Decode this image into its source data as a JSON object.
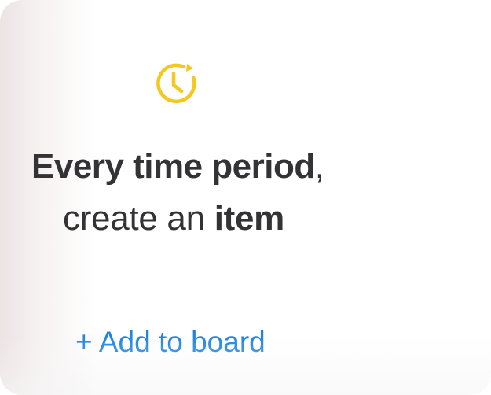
{
  "card": {
    "icon": "clock-refresh-icon",
    "accent_color": "#f5c81e",
    "link_color": "#1f84e0",
    "text_color": "#333336",
    "title_line1_bold": "Every time period",
    "title_line1_suffix": ",",
    "title_line2_light": "create an ",
    "title_line2_bold": "item",
    "add_link_label": "+ Add to board"
  }
}
